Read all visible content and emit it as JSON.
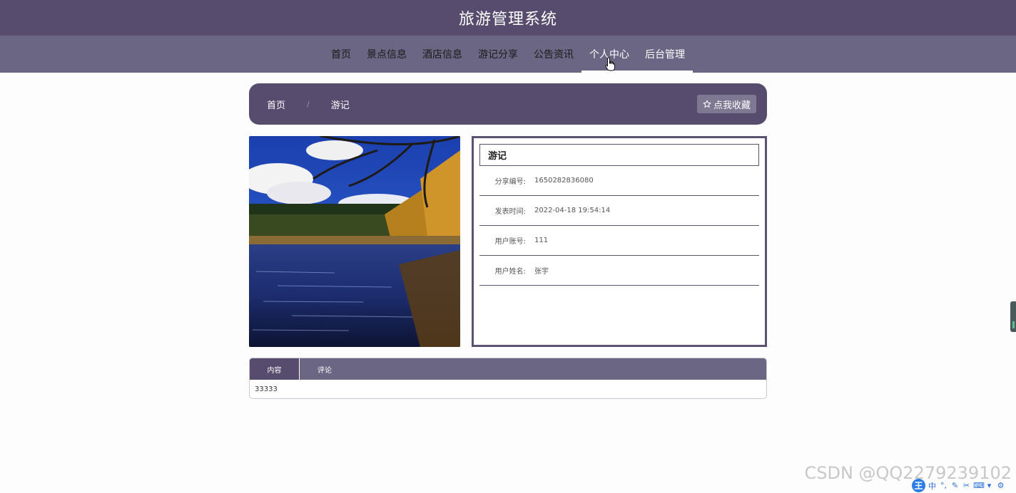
{
  "header": {
    "title": "旅游管理系统"
  },
  "nav": {
    "items": [
      {
        "label": "首页"
      },
      {
        "label": "景点信息"
      },
      {
        "label": "酒店信息"
      },
      {
        "label": "游记分享"
      },
      {
        "label": "公告资讯"
      },
      {
        "label": "个人中心"
      },
      {
        "label": "后台管理"
      }
    ]
  },
  "breadcrumb": {
    "home": "首页",
    "separator": "/",
    "current": "游记",
    "favorite_button": "点我收藏"
  },
  "detail": {
    "title": "游记",
    "fields": [
      {
        "label": "分享编号:",
        "value": "1650282836080"
      },
      {
        "label": "发表时间:",
        "value": "2022-04-18 19:54:14"
      },
      {
        "label": "用户账号:",
        "value": "111"
      },
      {
        "label": "用户姓名:",
        "value": "张宇"
      }
    ]
  },
  "tabs": {
    "items": [
      {
        "label": "内容"
      },
      {
        "label": "评论"
      }
    ],
    "content": "33333"
  },
  "watermark": "CSDN @QQ2279239102",
  "ime": {
    "logo": "王",
    "mode": "中"
  },
  "colors": {
    "primary": "#574c6e",
    "secondary": "#6b6683"
  }
}
